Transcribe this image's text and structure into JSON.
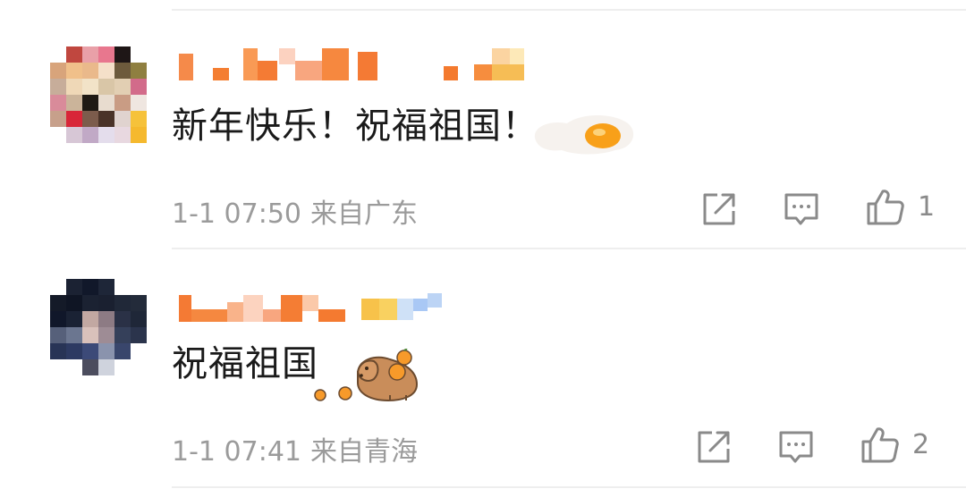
{
  "comments": [
    {
      "text": "新年快乐！祝福祖国！",
      "time": "1-1 07:50",
      "location": "来自广东",
      "likes": "1",
      "sticker_icon": "fried-egg-icon"
    },
    {
      "text": "祝福祖国",
      "time": "1-1 07:41",
      "location": "来自青海",
      "likes": "2",
      "sticker_icon": "capybara-orange-icon"
    }
  ],
  "actions": {
    "share_icon": "share-icon",
    "reply_icon": "comment-icon",
    "like_icon": "thumbs-up-icon"
  },
  "colors": {
    "text": "#1a1a1a",
    "meta": "#9b9b9b",
    "icon": "#8a8a8a",
    "divider": "#eeeeee"
  }
}
